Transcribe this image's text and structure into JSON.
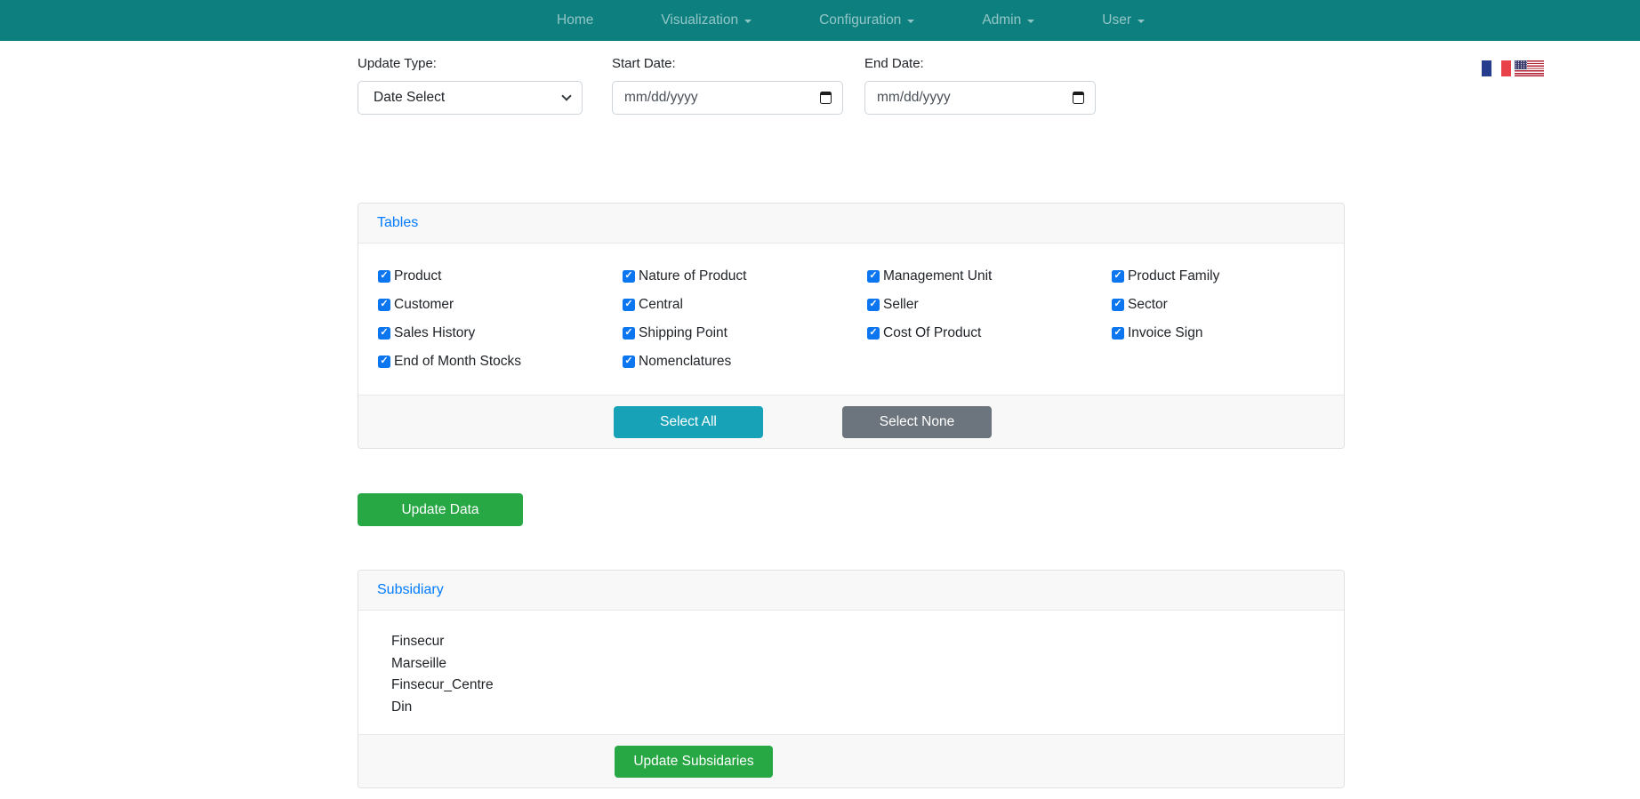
{
  "navbar": {
    "items": [
      {
        "label": "Home",
        "caret": false
      },
      {
        "label": "Visualization",
        "caret": true
      },
      {
        "label": "Configuration",
        "caret": true
      },
      {
        "label": "Admin",
        "caret": true
      },
      {
        "label": "User",
        "caret": true
      }
    ]
  },
  "language_flags": [
    {
      "name": "french-flag"
    },
    {
      "name": "us-flag"
    }
  ],
  "filters": {
    "update_type_label": "Update Type:",
    "update_type_value": "Date Select",
    "start_date_label": "Start Date:",
    "start_date_placeholder": "mm/dd/yyyy",
    "end_date_label": "End Date:",
    "end_date_placeholder": "mm/dd/yyyy"
  },
  "tables_card": {
    "title": "Tables",
    "checkboxes": [
      {
        "label": "Product",
        "checked": true
      },
      {
        "label": "Nature of Product",
        "checked": true
      },
      {
        "label": "Management Unit",
        "checked": true
      },
      {
        "label": "Product Family",
        "checked": true
      },
      {
        "label": "Customer",
        "checked": true
      },
      {
        "label": "Central",
        "checked": true
      },
      {
        "label": "Seller",
        "checked": true
      },
      {
        "label": "Sector",
        "checked": true
      },
      {
        "label": "Sales History",
        "checked": true
      },
      {
        "label": "Shipping Point",
        "checked": true
      },
      {
        "label": "Cost Of Product",
        "checked": true
      },
      {
        "label": "Invoice Sign",
        "checked": true
      },
      {
        "label": "End of Month Stocks",
        "checked": true
      },
      {
        "label": "Nomenclatures",
        "checked": true
      }
    ],
    "select_all_label": "Select All",
    "select_none_label": "Select None"
  },
  "actions": {
    "update_data_label": "Update Data"
  },
  "subsidiary_card": {
    "title": "Subsidiary",
    "items": [
      "Finsecur",
      "Marseille",
      "Finsecur_Centre",
      "Din"
    ],
    "update_button_label": "Update Subsidaries"
  },
  "colors": {
    "navbar_bg": "#0e7f7f",
    "card_title": "#007bff",
    "checkbox_accent": "#0b76ef",
    "select_all_bg": "#17a2b8",
    "select_none_bg": "#6c757d",
    "success_bg": "#28a745"
  }
}
